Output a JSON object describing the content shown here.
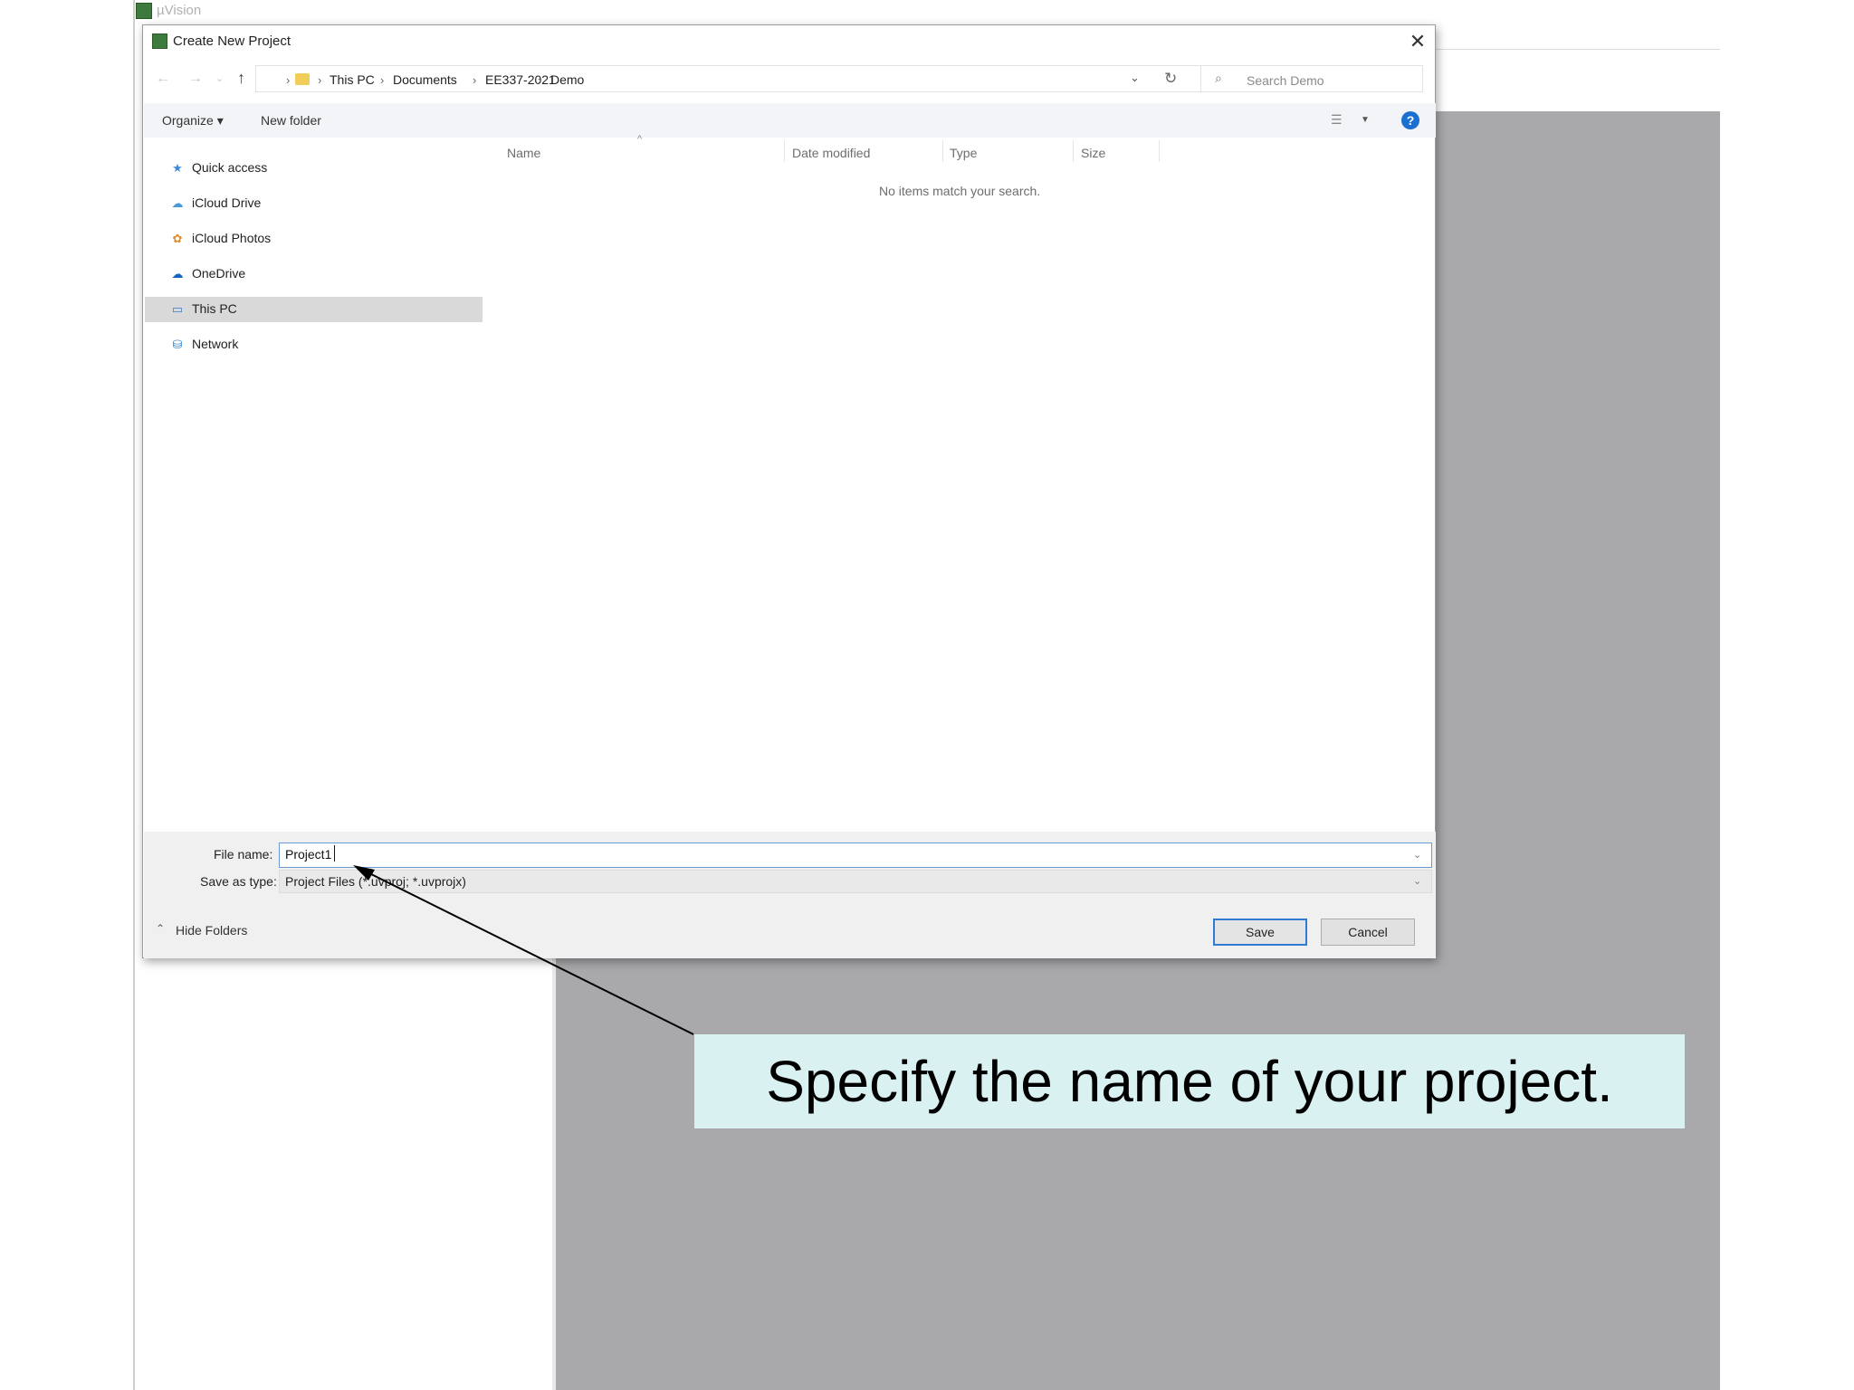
{
  "app": {
    "title": "µVision"
  },
  "dialog": {
    "title": "Create New Project",
    "breadcrumbs": [
      "This PC",
      "Documents",
      "EE337-2021",
      "Demo"
    ],
    "search_placeholder": "Search Demo",
    "toolbar": {
      "organize": "Organize ▾",
      "new_folder": "New folder"
    },
    "nav": [
      {
        "label": "Quick access",
        "icon": "quick-access-icon"
      },
      {
        "label": "iCloud Drive",
        "icon": "icloud-drive-icon"
      },
      {
        "label": "iCloud Photos",
        "icon": "icloud-photos-icon"
      },
      {
        "label": "OneDrive",
        "icon": "onedrive-icon"
      },
      {
        "label": "This PC",
        "icon": "this-pc-icon",
        "selected": true
      },
      {
        "label": "Network",
        "icon": "network-icon"
      }
    ],
    "columns": [
      "Name",
      "Date modified",
      "Type",
      "Size"
    ],
    "empty_message": "No items match your search.",
    "file_name": {
      "label": "File name:",
      "value": "Project1"
    },
    "save_as_type": {
      "label": "Save as type:",
      "value": "Project Files (*.uvproj; *.uvprojx)"
    },
    "hide_folders": "Hide Folders",
    "save_label": "Save",
    "cancel_label": "Cancel"
  },
  "annotation": {
    "text": "Specify the name of your project."
  },
  "colors": {
    "accent": "#2f7bd4",
    "callout_bg": "#daf1f1",
    "app_gray": "#a9a8ab"
  }
}
